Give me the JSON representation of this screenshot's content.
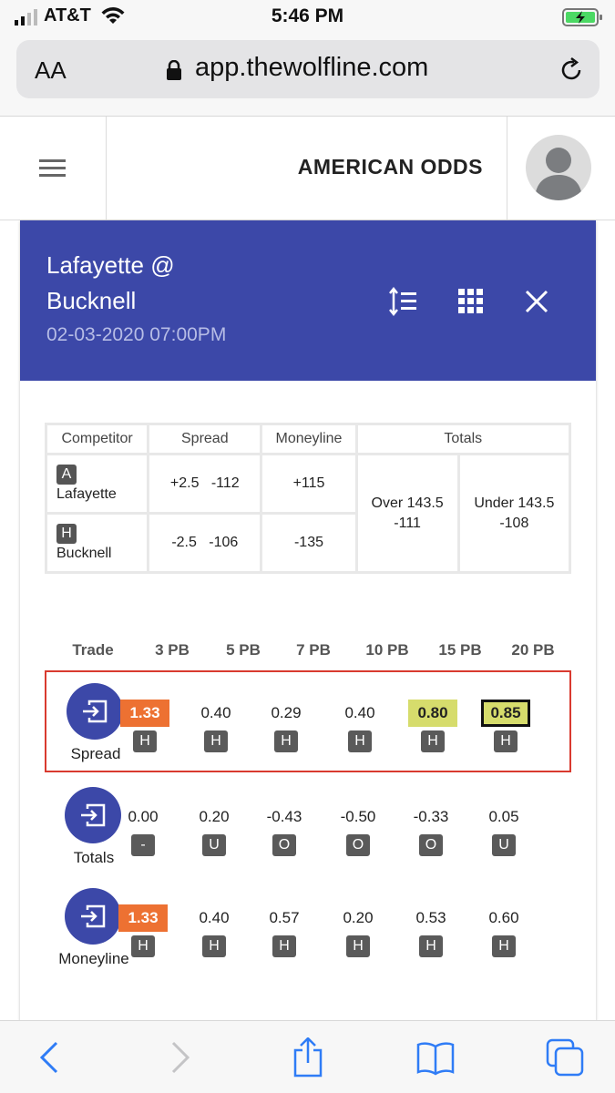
{
  "status_bar": {
    "carrier": "AT&T",
    "time": "5:46 PM"
  },
  "browser": {
    "text_size_label": "AA",
    "url": "app.thewolfline.com"
  },
  "header": {
    "title": "AMERICAN ODDS"
  },
  "game": {
    "title_line1": "Lafayette @",
    "title_line2": "Bucknell",
    "datetime": "02-03-2020 07:00PM",
    "accent_color": "#3c48a8"
  },
  "odds": {
    "headers": [
      "Competitor",
      "Spread",
      "Moneyline",
      "Totals"
    ],
    "teams": [
      {
        "badge": "A",
        "name": "Lafayette",
        "spread": "+2.5",
        "spread_odds": "-112",
        "moneyline": "+115"
      },
      {
        "badge": "H",
        "name": "Bucknell",
        "spread": "-2.5",
        "spread_odds": "-106",
        "moneyline": "-135"
      }
    ],
    "over": {
      "label": "Over 143.5",
      "odds": "-111"
    },
    "under": {
      "label": "Under 143.5",
      "odds": "-108"
    }
  },
  "trade": {
    "header_label": "Trade",
    "columns": [
      "3 PB",
      "5 PB",
      "7 PB",
      "10 PB",
      "15 PB",
      "20 PB"
    ],
    "rows": [
      {
        "label": "Spread",
        "selected": true,
        "cells": [
          {
            "value": "1.33",
            "tag": "H",
            "style": "orange"
          },
          {
            "value": "0.40",
            "tag": "H",
            "style": ""
          },
          {
            "value": "0.29",
            "tag": "H",
            "style": ""
          },
          {
            "value": "0.40",
            "tag": "H",
            "style": ""
          },
          {
            "value": "0.80",
            "tag": "H",
            "style": "yellow"
          },
          {
            "value": "0.85",
            "tag": "H",
            "style": "yellow outlined"
          }
        ]
      },
      {
        "label": "Totals",
        "selected": false,
        "cells": [
          {
            "value": "0.00",
            "tag": "-",
            "style": ""
          },
          {
            "value": "0.20",
            "tag": "U",
            "style": ""
          },
          {
            "value": "-0.43",
            "tag": "O",
            "style": ""
          },
          {
            "value": "-0.50",
            "tag": "O",
            "style": ""
          },
          {
            "value": "-0.33",
            "tag": "O",
            "style": ""
          },
          {
            "value": "0.05",
            "tag": "U",
            "style": ""
          }
        ]
      },
      {
        "label": "Moneyline",
        "selected": false,
        "cells": [
          {
            "value": "1.33",
            "tag": "H",
            "style": "orange"
          },
          {
            "value": "0.40",
            "tag": "H",
            "style": ""
          },
          {
            "value": "0.57",
            "tag": "H",
            "style": ""
          },
          {
            "value": "0.20",
            "tag": "H",
            "style": ""
          },
          {
            "value": "0.53",
            "tag": "H",
            "style": ""
          },
          {
            "value": "0.60",
            "tag": "H",
            "style": ""
          }
        ]
      }
    ]
  },
  "colors": {
    "highlight_orange": "#ed7132",
    "highlight_yellow": "#d6dc6c",
    "selected_border": "#d93a2f",
    "ios_blue": "#2f7cf6"
  }
}
